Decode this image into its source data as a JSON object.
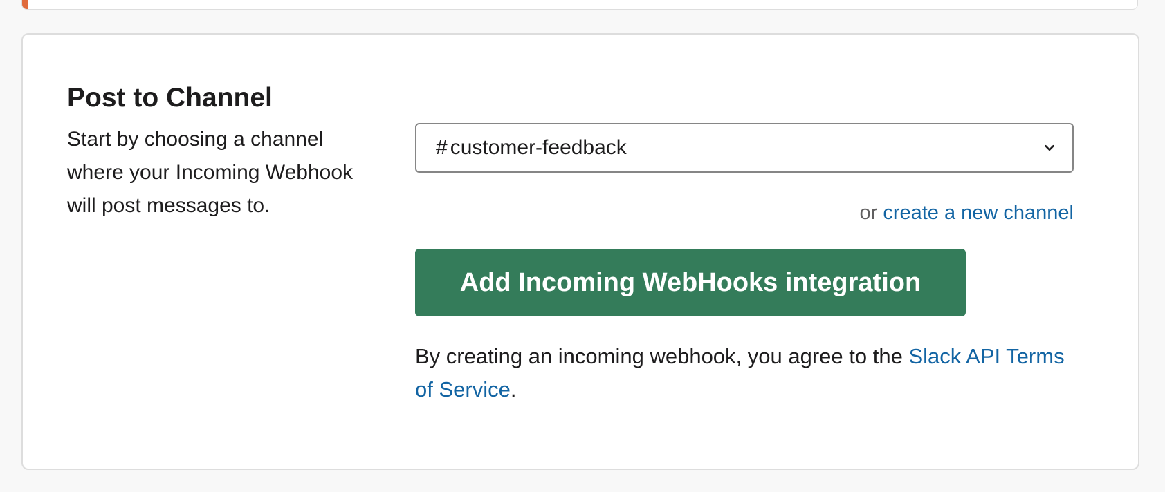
{
  "colors": {
    "accent_bar": "#e06b3c",
    "primary_button": "#347c5a",
    "link": "#1264a3",
    "text": "#1d1c1d",
    "muted_text": "#616061"
  },
  "section": {
    "title": "Post to Channel",
    "description": "Start by choosing a channel where your Incoming Webhook will post messages to."
  },
  "channel_select": {
    "prefix": "#",
    "selected_value": "customer-feedback",
    "icon": "chevron-down-icon"
  },
  "alt_action": {
    "prefix": "or ",
    "link_text": "create a new channel"
  },
  "primary_button": {
    "label": "Add Incoming WebHooks integration"
  },
  "terms": {
    "text": "By creating an incoming webhook, you agree to the ",
    "link_text": "Slack API Terms of Service",
    "suffix": "."
  }
}
